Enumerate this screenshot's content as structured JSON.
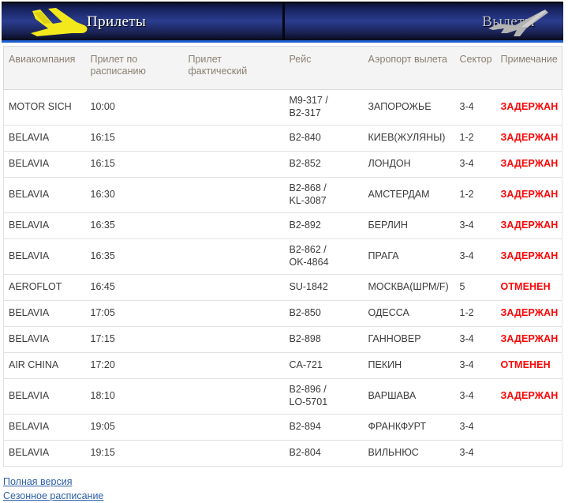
{
  "tabs": [
    {
      "label": "Прилеты",
      "icon": "plane-landing-icon",
      "active": true
    },
    {
      "label": "Вылеты",
      "icon": "plane-takeoff-icon",
      "active": false
    }
  ],
  "table": {
    "headers": [
      "Авиакомпания",
      "Прилет по расписанию",
      "Прилет фактический",
      "Рейс",
      "Аэропорт вылета",
      "Сектор",
      "Примечание"
    ],
    "rows": [
      {
        "airline": "MOTOR SICH",
        "scheduled": "10:00",
        "actual": "",
        "flight": "M9-317 /\nB2-317",
        "airport": "ЗАПОРОЖЬЕ",
        "sector": "3-4",
        "note": "ЗАДЕРЖАН"
      },
      {
        "airline": "BELAVIA",
        "scheduled": "16:15",
        "actual": "",
        "flight": "B2-840",
        "airport": "КИЕВ(ЖУЛЯНЫ)",
        "sector": "1-2",
        "note": "ЗАДЕРЖАН"
      },
      {
        "airline": "BELAVIA",
        "scheduled": "16:15",
        "actual": "",
        "flight": "B2-852",
        "airport": "ЛОНДОН",
        "sector": "3-4",
        "note": "ЗАДЕРЖАН"
      },
      {
        "airline": "BELAVIA",
        "scheduled": "16:30",
        "actual": "",
        "flight": "B2-868 /\nKL-3087",
        "airport": "АМСТЕРДАМ",
        "sector": "1-2",
        "note": "ЗАДЕРЖАН"
      },
      {
        "airline": "BELAVIA",
        "scheduled": "16:35",
        "actual": "",
        "flight": "B2-892",
        "airport": "БЕРЛИН",
        "sector": "3-4",
        "note": "ЗАДЕРЖАН"
      },
      {
        "airline": "BELAVIA",
        "scheduled": "16:35",
        "actual": "",
        "flight": "B2-862 /\nOK-4864",
        "airport": "ПРАГА",
        "sector": "3-4",
        "note": "ЗАДЕРЖАН"
      },
      {
        "airline": "AEROFLOT",
        "scheduled": "16:45",
        "actual": "",
        "flight": "SU-1842",
        "airport": "МОСКВА(ШРМ/F)",
        "sector": "5",
        "note": "ОТМЕНЕН"
      },
      {
        "airline": "BELAVIA",
        "scheduled": "17:05",
        "actual": "",
        "flight": "B2-850",
        "airport": "ОДЕССА",
        "sector": "1-2",
        "note": "ЗАДЕРЖАН"
      },
      {
        "airline": "BELAVIA",
        "scheduled": "17:15",
        "actual": "",
        "flight": "B2-898",
        "airport": "ГАННОВЕР",
        "sector": "3-4",
        "note": "ЗАДЕРЖАН"
      },
      {
        "airline": "AIR CHINA",
        "scheduled": "17:20",
        "actual": "",
        "flight": "CA-721",
        "airport": "ПЕКИН",
        "sector": "3-4",
        "note": "ОТМЕНЕН"
      },
      {
        "airline": "BELAVIA",
        "scheduled": "18:10",
        "actual": "",
        "flight": "B2-896 /\nLO-5701",
        "airport": "ВАРШАВА",
        "sector": "3-4",
        "note": "ЗАДЕРЖАН"
      },
      {
        "airline": "BELAVIA",
        "scheduled": "19:05",
        "actual": "",
        "flight": "B2-894",
        "airport": "ФРАНКФУРТ",
        "sector": "3-4",
        "note": ""
      },
      {
        "airline": "BELAVIA",
        "scheduled": "19:15",
        "actual": "",
        "flight": "B2-804",
        "airport": "ВИЛЬНЮС",
        "sector": "3-4",
        "note": ""
      }
    ]
  },
  "footer": {
    "links": [
      "Полная версия",
      "Сезонное расписание"
    ]
  },
  "colors": {
    "status_red": "#fb0505",
    "link_blue": "#2c5fa8",
    "header_text": "#8a7f72",
    "tab_active_text": "#ffffff",
    "tab_inactive_text": "#b9bdcc",
    "plane_arrive": "#f2e81c",
    "plane_depart": "#b3b3b3"
  }
}
